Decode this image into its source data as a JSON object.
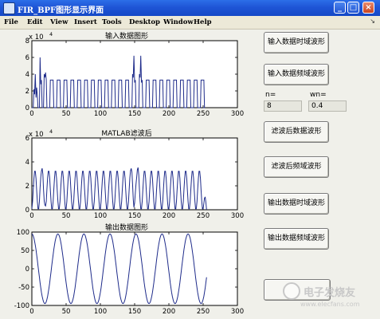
{
  "window": {
    "title": "FIR_BPF图形显示界面",
    "controls": {
      "minimize": "_",
      "maximize": "□",
      "close": "×"
    }
  },
  "menu": {
    "items": [
      "File",
      "Edit",
      "View",
      "Insert",
      "Tools",
      "Desktop",
      "Window",
      "Help"
    ]
  },
  "buttons": {
    "input_time": "输入数据时域波形",
    "input_freq": "输入数据频域波形",
    "filtered_data": "滤波后数据波形",
    "filtered_freq": "滤波后频域波形",
    "output_time": "输出数据时域波形",
    "output_freq": "输出数据频域波形"
  },
  "params": {
    "n_label": "n=",
    "n_value": "8",
    "wn_label": "wn=",
    "wn_value": "0.4"
  },
  "watermark": {
    "text": "电子发烧友",
    "url": "www.elecfans.com"
  },
  "chart_data": [
    {
      "type": "line",
      "title": "输入数据图形",
      "exponent_label": "x 10",
      "exponent": "4",
      "xlim": [
        0,
        300
      ],
      "ylim": [
        0,
        80000
      ],
      "xticks": [
        "0",
        "50",
        "100",
        "150",
        "200",
        "250",
        "300"
      ],
      "yticks": [
        "0",
        "2",
        "4",
        "6",
        "8"
      ],
      "color": "#1e2b8a",
      "description": "square-wave-like pulses between 0 and ~33000 with spikes near x=20 (~60000) and x=150 (~62000)",
      "x": [
        0,
        3,
        5,
        8,
        10,
        12,
        15,
        18,
        20,
        23,
        25,
        30,
        35,
        40,
        145,
        148,
        150,
        153,
        155,
        160,
        250
      ],
      "y": [
        0,
        22000,
        18000,
        40000,
        12000,
        60000,
        35000,
        42000,
        33000,
        38000,
        33000,
        0,
        33000,
        0,
        40000,
        35000,
        62000,
        30000,
        33000,
        0,
        0
      ]
    },
    {
      "type": "line",
      "title": "MATLAB滤波后",
      "exponent_label": "x 10",
      "exponent": "4",
      "xlim": [
        0,
        300
      ],
      "ylim": [
        0,
        60000
      ],
      "xticks": [
        "0",
        "50",
        "100",
        "150",
        "200",
        "250",
        "300"
      ],
      "yticks": [
        "0",
        "2",
        "4",
        "6"
      ],
      "color": "#1e2b8a",
      "description": "smoothed periodic waveform peaking ~33000, with bumps ~36000 near x=20 and ~40000 near x=150",
      "peak": 33000
    },
    {
      "type": "line",
      "title": "输出数据图形",
      "xlim": [
        0,
        300
      ],
      "ylim": [
        -100,
        100
      ],
      "xticks": [
        "0",
        "50",
        "100",
        "150",
        "200",
        "250",
        "300"
      ],
      "yticks": [
        "-100",
        "-50",
        "0",
        "50",
        "100"
      ],
      "color": "#1e2b8a",
      "description": "sinusoid with amplitude ~95 and period ~38 samples, from x=0 to ~255",
      "amplitude": 95,
      "period": 38
    }
  ]
}
